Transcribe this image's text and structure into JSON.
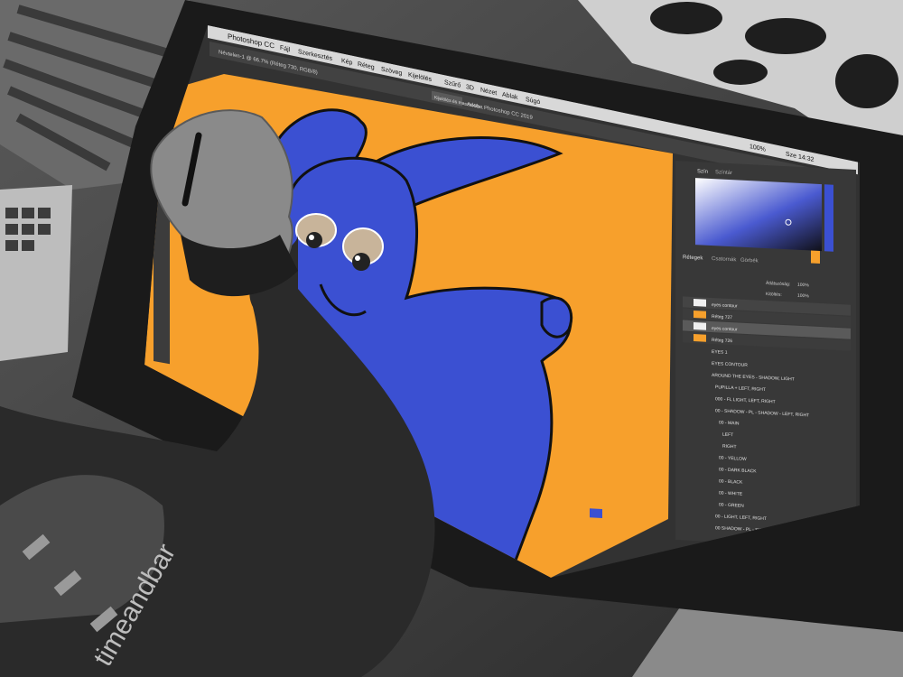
{
  "menu_bar": {
    "app_name": "Photoshop CC",
    "items": [
      "Fájl",
      "Szerkesztés",
      "Kép",
      "Réteg",
      "Szöveg",
      "Kijelölés",
      "Szűrő",
      "3D",
      "Nézet",
      "Ablak",
      "Súgó"
    ],
    "status_right": "100%",
    "clock": "Sze 14:32"
  },
  "options_bar": {
    "document_tab": "Névtelen-1 @ 66.7% (Réteg 730, RGB/8)",
    "buttons": [
      "Kijelölés és maszkolás..."
    ]
  },
  "window_title": "Adobe Photoshop CC 2019",
  "panels": {
    "color_tabs": [
      "Szín",
      "Színtár"
    ],
    "adjust_tabs": [
      "Rétegek",
      "Csatornák",
      "Görbék"
    ],
    "opacity_label": "Átlátszóság:",
    "opacity_value": "100%",
    "fill_label": "Kitöltés:",
    "fill_value": "100%",
    "layers": [
      "eyes contour",
      "Réteg 727",
      "eyes contour",
      "Réteg 726",
      "EYES 1",
      "EYES CONTOUR",
      "AROUND THE EYES - SHADOW, LIGHT",
      "PUPILLA + LEFT, RIGHT",
      "000 - FL LIGHT, LEFT, RIGHT",
      "00 - SHADOW - PL - SHADOW - LEFT, RIGHT",
      "00 - MAIN",
      "LEFT",
      "RIGHT",
      "00 - YELLOW",
      "00 - DARK BLACK",
      "00 - BLACK",
      "00 - WHITE",
      "00 - GREEN",
      "00 - LIGHT, LEFT, RIGHT",
      "00 SHADOW - PL - SHADOW - LEFT, RIGHT"
    ]
  },
  "sleeve_text": "timeandbar",
  "colors": {
    "canvas_orange": "#f7a02c",
    "character_blue": "#3b50d2",
    "ui_dark": "#323232",
    "tablet_bezel": "#1a1a1a",
    "sleeve": "#2a2a2a"
  }
}
